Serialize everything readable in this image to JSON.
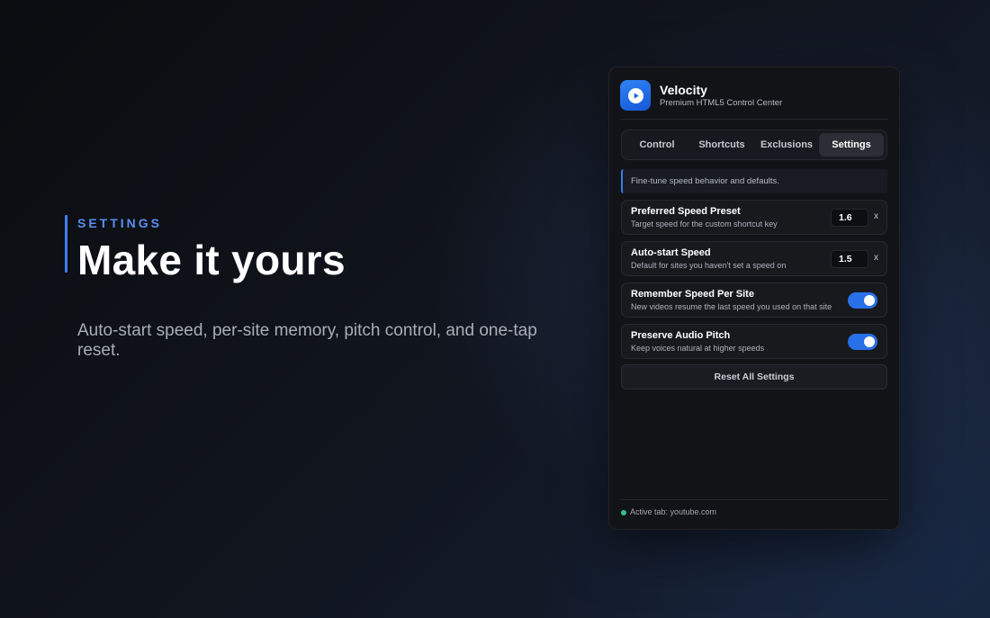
{
  "hero": {
    "eyebrow": "SETTINGS",
    "title": "Make it yours",
    "subtitle": "Auto-start speed, per-site memory, pitch control, and one-tap reset."
  },
  "app": {
    "name": "Velocity",
    "subtitle": "Premium HTML5 Control Center",
    "logo_icon": "play-icon"
  },
  "tabs": [
    {
      "label": "Control",
      "active": false
    },
    {
      "label": "Shortcuts",
      "active": false
    },
    {
      "label": "Exclusions",
      "active": false
    },
    {
      "label": "Settings",
      "active": true
    }
  ],
  "info_text": "Fine-tune speed behavior and defaults.",
  "settings": {
    "preferred": {
      "title": "Preferred Speed Preset",
      "desc": "Target speed for the custom shortcut key",
      "value": "1.6",
      "unit": "x"
    },
    "autostart": {
      "title": "Auto-start Speed",
      "desc": "Default for sites you haven't set a speed on",
      "value": "1.5",
      "unit": "x"
    },
    "remember": {
      "title": "Remember Speed Per Site",
      "desc": "New videos resume the last speed you used on that site",
      "enabled": true
    },
    "pitch": {
      "title": "Preserve Audio Pitch",
      "desc": "Keep voices natural at higher speeds",
      "enabled": true
    }
  },
  "reset_label": "Reset All Settings",
  "footer": {
    "status_text": "Active tab: youtube.com",
    "status_color": "#2fc38b"
  },
  "colors": {
    "accent": "#3d7ef0",
    "toggle_on": "#2870e8"
  }
}
